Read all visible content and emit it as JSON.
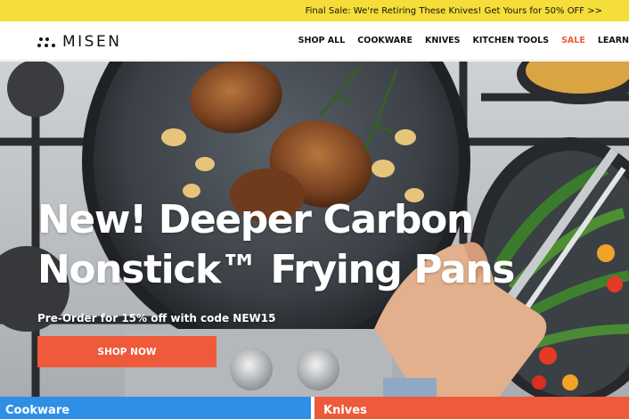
{
  "promo": {
    "text": "Final Sale: We're Retiring These Knives! Get Yours for 50% OFF >>"
  },
  "header": {
    "brand": "MISEN",
    "nav": [
      {
        "label": "SHOP ALL"
      },
      {
        "label": "COOKWARE"
      },
      {
        "label": "KNIVES"
      },
      {
        "label": "KITCHEN TOOLS"
      },
      {
        "label": "SALE"
      },
      {
        "label": "LEARN"
      }
    ]
  },
  "hero": {
    "title": "New! Deeper Carbon Nonstick™ Frying Pans",
    "subtitle": "Pre-Order for 15% off with code NEW15",
    "cta": "SHOP NOW"
  },
  "categories": [
    {
      "label": "Cookware"
    },
    {
      "label": "Knives"
    }
  ],
  "colors": {
    "promo_bg": "#f5dd3a",
    "accent": "#ef5a3b",
    "cookware_card": "#2f8fe6",
    "sale_link": "#ef5a3b"
  },
  "icons": {
    "logo": "misen-dots-logo-icon"
  }
}
